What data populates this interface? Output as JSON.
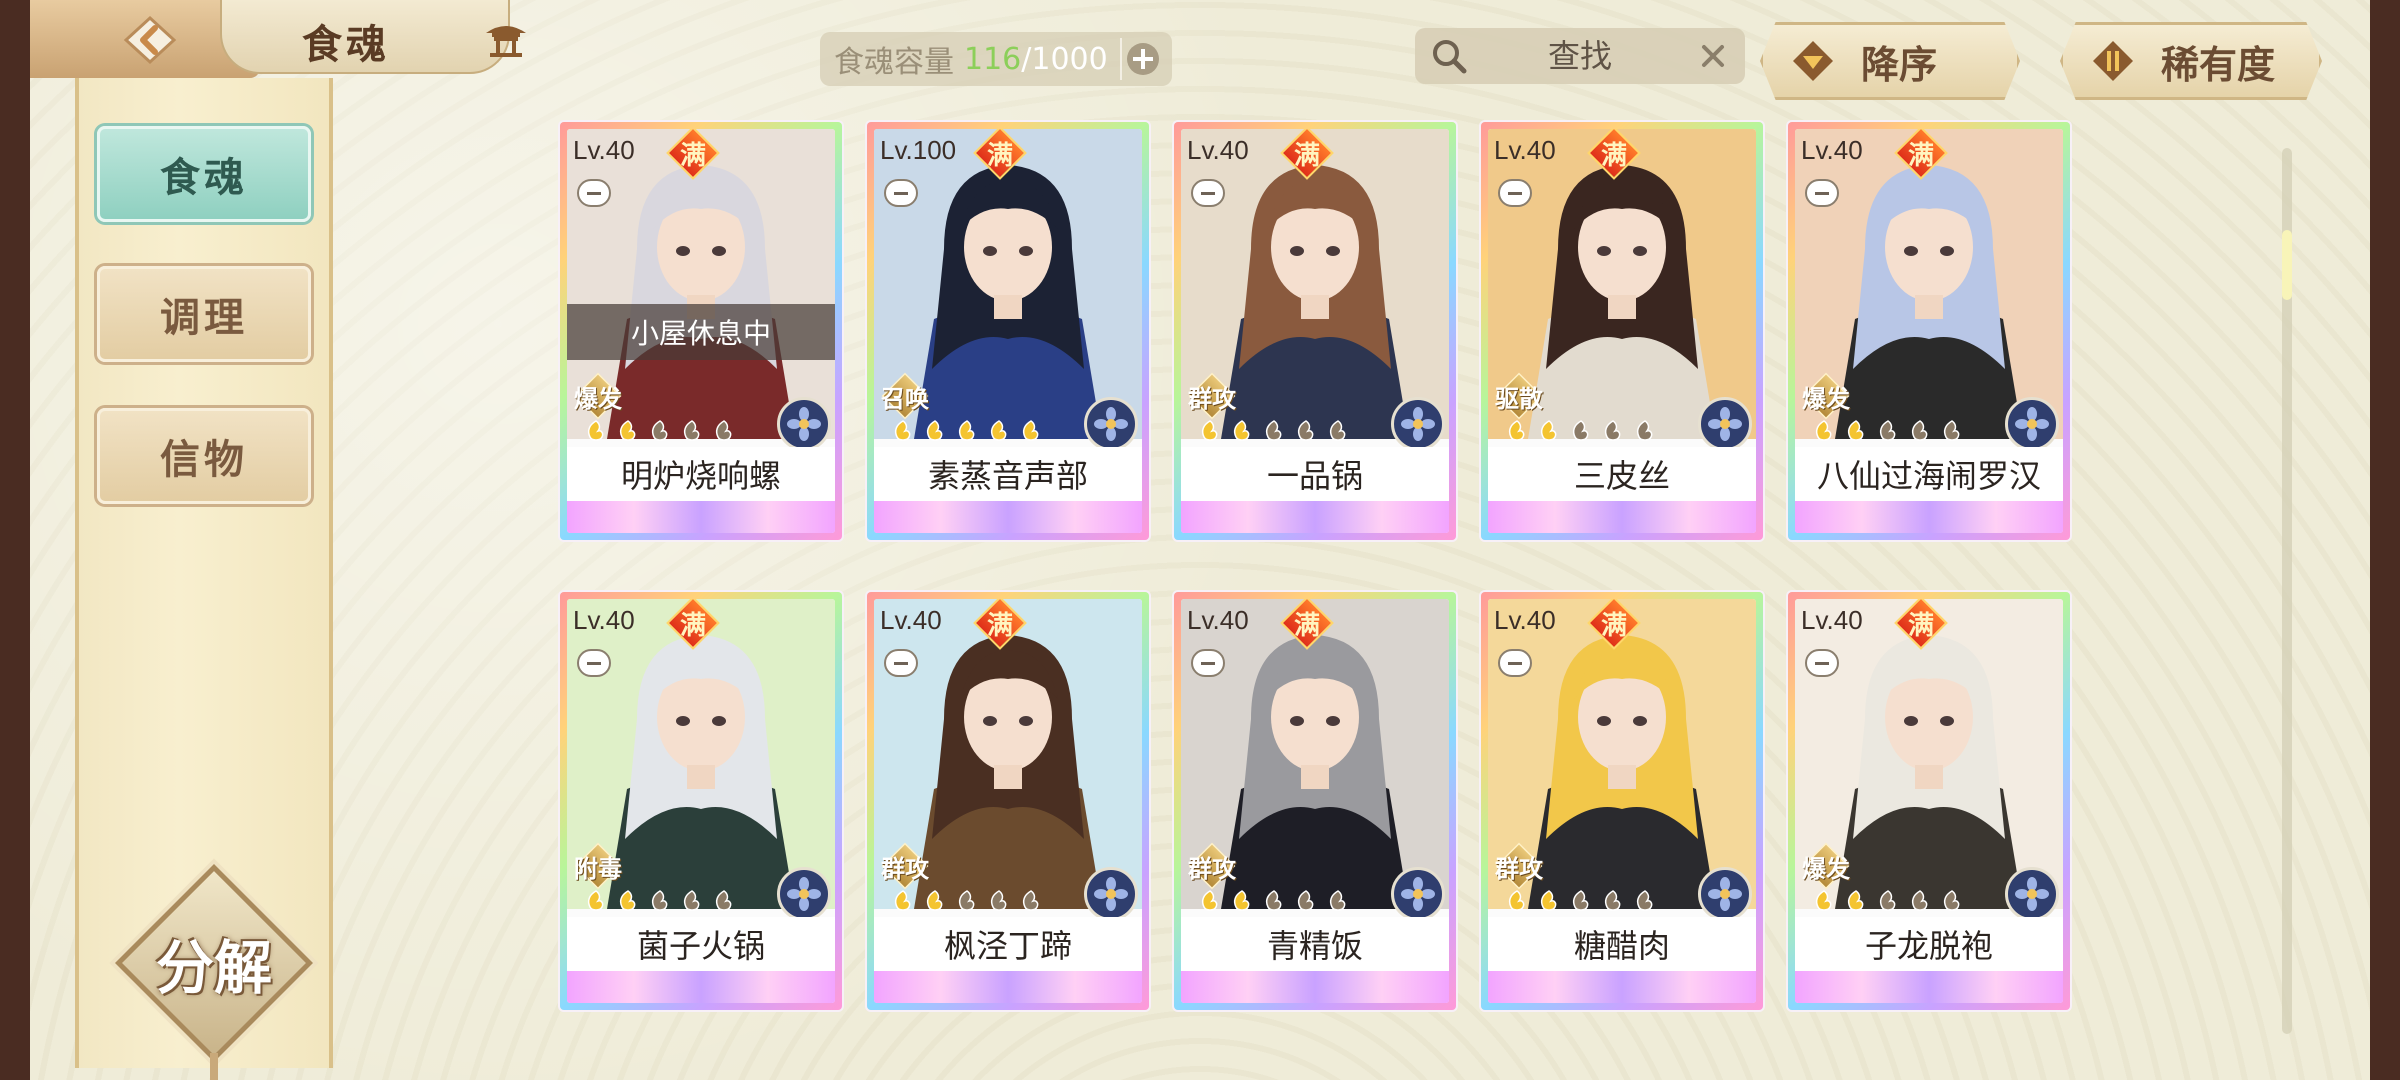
{
  "header": {
    "title": "食魂",
    "capacity_label": "食魂容量",
    "capacity_current": "116",
    "capacity_sep": "/",
    "capacity_max": "1000",
    "search_placeholder": "查找",
    "sort_label": "降序",
    "rarity_label": "稀有度"
  },
  "sidebar": {
    "items": [
      {
        "label": "食魂",
        "active": true
      },
      {
        "label": "调理",
        "active": false
      },
      {
        "label": "信物",
        "active": false
      }
    ],
    "decompose_label": "分解"
  },
  "cards": [
    {
      "level": "Lv.40",
      "full": "满",
      "name": "明炉烧响螺",
      "role": "爆发",
      "stars_lit": 2,
      "stars_total": 5,
      "status": "小屋休息中",
      "hair": "#d9d7de",
      "outfit": "#7a2a2a",
      "bg": "#e9e0d8"
    },
    {
      "level": "Lv.100",
      "full": "满",
      "name": "素蒸音声部",
      "role": "召唤",
      "stars_lit": 5,
      "stars_total": 5,
      "status": "",
      "hair": "#1c2234",
      "outfit": "#2a3f86",
      "bg": "#c9d9e8"
    },
    {
      "level": "Lv.40",
      "full": "满",
      "name": "一品锅",
      "role": "群攻",
      "stars_lit": 2,
      "stars_total": 5,
      "status": "",
      "hair": "#8a5a3e",
      "outfit": "#2d3550",
      "bg": "#e7dccb"
    },
    {
      "level": "Lv.40",
      "full": "满",
      "name": "三皮丝",
      "role": "驱散",
      "stars_lit": 2,
      "stars_total": 5,
      "status": "",
      "hair": "#3a2620",
      "outfit": "#e2dbcf",
      "bg": "#f0c98a"
    },
    {
      "level": "Lv.40",
      "full": "满",
      "name": "八仙过海闹罗汉",
      "role": "爆发",
      "stars_lit": 2,
      "stars_total": 5,
      "status": "",
      "hair": "#b8c6e6",
      "outfit": "#2a2a2a",
      "bg": "#f0d2b8"
    },
    {
      "level": "Lv.40",
      "full": "满",
      "name": "菌子火锅",
      "role": "附毒",
      "stars_lit": 2,
      "stars_total": 5,
      "status": "",
      "hair": "#e3e6ea",
      "outfit": "#2b3f3a",
      "bg": "#dff0c8"
    },
    {
      "level": "Lv.40",
      "full": "满",
      "name": "枫泾丁蹄",
      "role": "群攻",
      "stars_lit": 2,
      "stars_total": 5,
      "status": "",
      "hair": "#4a2f22",
      "outfit": "#6b4b2e",
      "bg": "#cde6ee"
    },
    {
      "level": "Lv.40",
      "full": "满",
      "name": "青精饭",
      "role": "群攻",
      "stars_lit": 2,
      "stars_total": 5,
      "status": "",
      "hair": "#9a9a9e",
      "outfit": "#1e1e26",
      "bg": "#d9d4cf"
    },
    {
      "level": "Lv.40",
      "full": "满",
      "name": "糖醋肉",
      "role": "群攻",
      "stars_lit": 2,
      "stars_total": 5,
      "status": "",
      "hair": "#f2c74a",
      "outfit": "#2a2a2e",
      "bg": "#f4d89a"
    },
    {
      "level": "Lv.40",
      "full": "满",
      "name": "子龙脱袍",
      "role": "爆发",
      "stars_lit": 2,
      "stars_total": 5,
      "status": "",
      "hair": "#ebe8e0",
      "outfit": "#3a3630",
      "bg": "#f3ece2"
    }
  ],
  "colors": {
    "accent_teal": "#8fd0c0",
    "capacity_current": "#8ccf5a",
    "star_lit": "#f4c430",
    "star_dim": "#8a7a66"
  },
  "scroll": {
    "position": 0.1
  }
}
